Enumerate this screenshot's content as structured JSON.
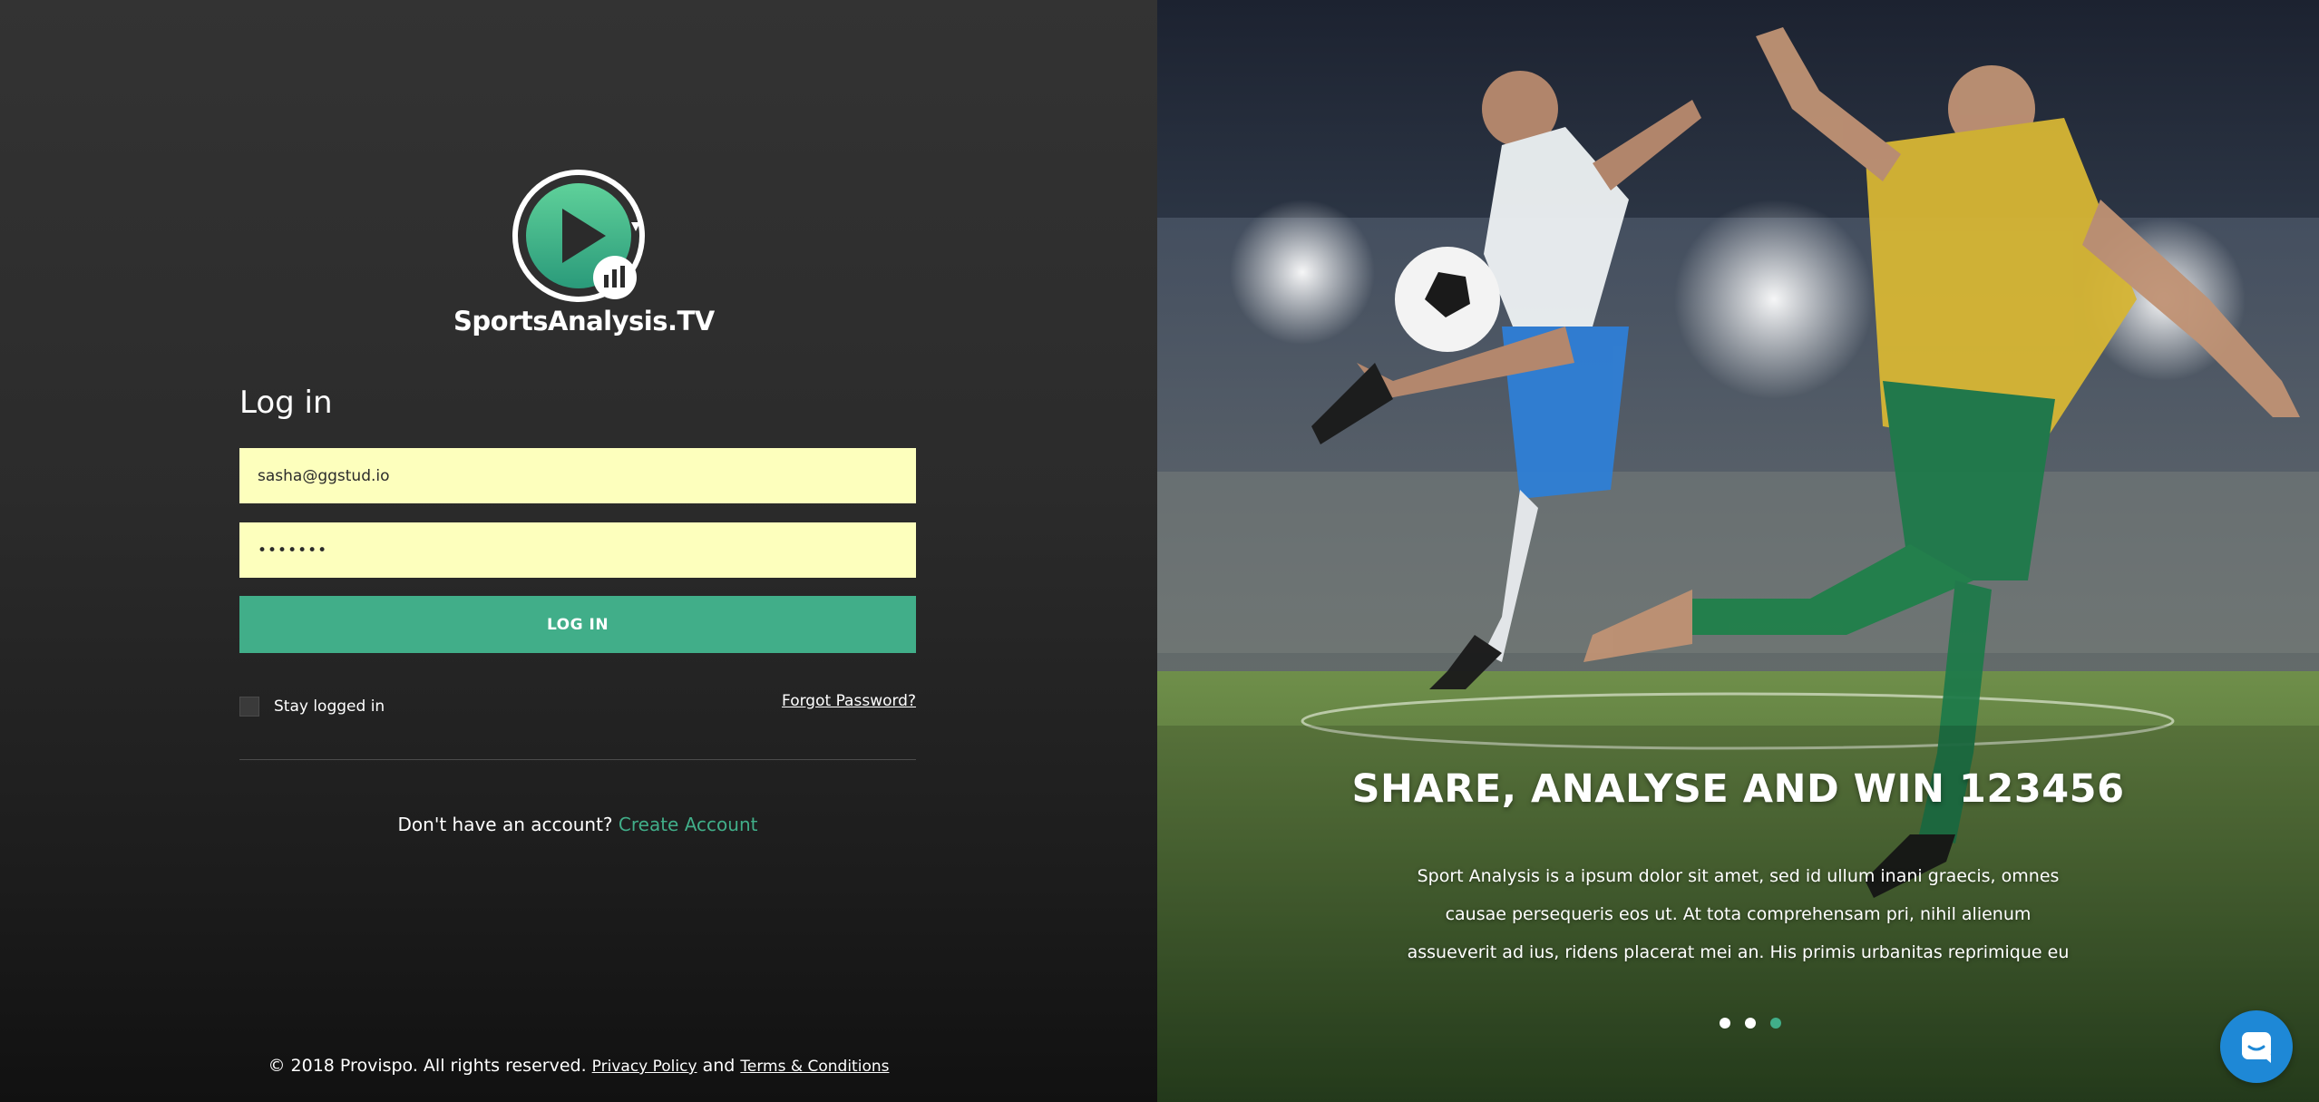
{
  "brand": {
    "name": "SportsAnalysis.TV",
    "logo_icon": "play-circle-chart-logo"
  },
  "login": {
    "title": "Log in",
    "email_value": "sasha@ggstud.io",
    "password_value": "•••••••",
    "submit_label": "LOG IN",
    "stay_logged_in_label": "Stay logged in",
    "stay_logged_in_checked": false,
    "forgot_label": "Forgot Password?"
  },
  "signup": {
    "prompt": "Don't have an account?",
    "link_label": "Create Account"
  },
  "footer": {
    "copyright": "© 2018 Provispo. All rights reserved.",
    "privacy_label": "Privacy Policy",
    "and_text": "and",
    "terms_label": "Terms & Conditions"
  },
  "hero": {
    "title": "SHARE, ANALYSE AND WIN 123456",
    "description": "Sport Analysis is a ipsum dolor sit amet, sed id ullum inani graecis, omnes causae persequeris eos ut. At tota comprehensam pri, nihil alienum assueverit ad ius, ridens placerat mei an. His primis urbanitas reprimique eu",
    "slides_count": 3,
    "active_slide": 3,
    "image_subject": "two soccer players in stadium"
  },
  "chat": {
    "icon": "chat-icon"
  },
  "colors": {
    "accent": "#41ae89",
    "input_bg": "#fdffbd",
    "chat": "#1e88d6",
    "left_bg": "#2b2b2b"
  }
}
